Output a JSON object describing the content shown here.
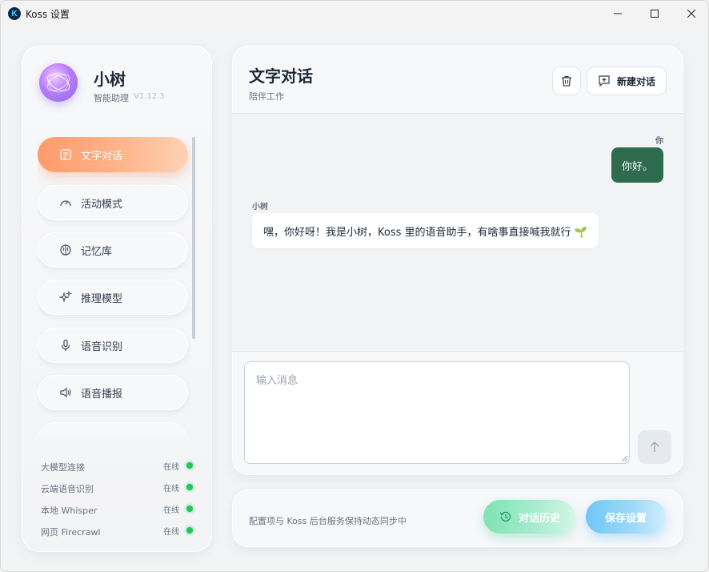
{
  "window": {
    "app_icon_letter": "K",
    "title": "Koss 设置"
  },
  "profile": {
    "name": "小树",
    "subtitle": "智能助理",
    "version": "V1.12.3"
  },
  "nav": {
    "items": [
      {
        "label": "文字对话",
        "icon": "chat-icon",
        "active": true
      },
      {
        "label": "活动模式",
        "icon": "gauge-icon",
        "active": false
      },
      {
        "label": "记忆库",
        "icon": "brain-icon",
        "active": false
      },
      {
        "label": "推理模型",
        "icon": "sparkles-icon",
        "active": false
      },
      {
        "label": "语音识别",
        "icon": "microphone-icon",
        "active": false
      },
      {
        "label": "语音播报",
        "icon": "speaker-icon",
        "active": false
      }
    ]
  },
  "status": {
    "items": [
      {
        "label": "大模型连接",
        "value": "在线"
      },
      {
        "label": "云端语音识别",
        "value": "在线"
      },
      {
        "label": "本地 Whisper",
        "value": "在线"
      },
      {
        "label": "网页 Firecrawl",
        "value": "在线"
      }
    ],
    "online_color": "#22c55e"
  },
  "chat": {
    "title": "文字对话",
    "subtitle": "陪伴工作",
    "new_chat_label": "新建对话",
    "messages": [
      {
        "role": "user",
        "sender": "你",
        "text": "你好。"
      },
      {
        "role": "assistant",
        "sender": "小树",
        "text": "嘿，你好呀！我是小树，Koss 里的语音助手，有啥事直接喊我就行 🌱"
      }
    ],
    "input_placeholder": "输入消息",
    "input_value": ""
  },
  "footer": {
    "note": "配置项与 Koss 后台服务保持动态同步中",
    "history_label": "对话历史",
    "save_label": "保存设置"
  },
  "colors": {
    "active_nav": "#ff9a6b",
    "user_bubble": "#2e6b4f",
    "history_button": "#7fe3b3",
    "save_button": "#6ec7f5"
  }
}
